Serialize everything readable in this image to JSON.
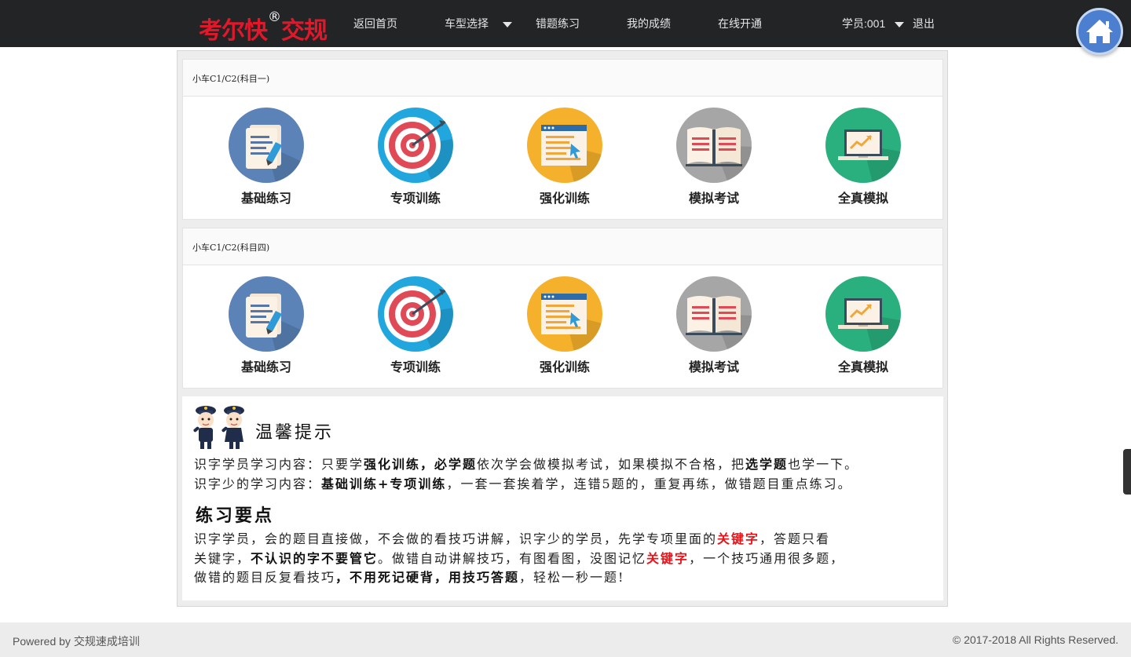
{
  "header": {
    "brand": "考尔快",
    "brand_reg": "®",
    "brand_suffix": "交规",
    "nav": {
      "home": "返回首页",
      "car_type": "车型选择",
      "wrong": "错题练习",
      "scores": "我的成绩",
      "online": "在线开通"
    },
    "user": "学员:001",
    "logout": "退出"
  },
  "sections": [
    {
      "title": "小车C1/C2(科目一)",
      "items": [
        "基础练习",
        "专项训练",
        "强化训练",
        "模拟考试",
        "全真模拟"
      ]
    },
    {
      "title": "小车C1/C2(科目四)",
      "items": [
        "基础练习",
        "专项训练",
        "强化训练",
        "模拟考试",
        "全真模拟"
      ]
    }
  ],
  "tips": {
    "title": "温馨提示",
    "line1": {
      "a": "识字学员学习内容：只要学",
      "b": "强化训练，必学题",
      "c": "依次学会做模拟考试，如果模拟不合格，把",
      "d": "选学题",
      "e": "也学一下。"
    },
    "line2": {
      "a": "识字少的学习内容：",
      "b": "基础训练+专项训练",
      "c": "，一套一套挨着学，连错5题的，重复再练，做错题目重点练习。"
    },
    "points_title": "练习要点",
    "p1": {
      "a": "识字学员，会的题目直接做，不会做的看技巧讲解，识字少的学员，先学专项里面的",
      "b": "关键字",
      "c": "，答题只看"
    },
    "p2": {
      "a": "关键字，",
      "b": "不认识的字不要管它",
      "c": "。做错自动讲解技巧，有图看图，没图记忆",
      "d": "关键字",
      "e": "，一个技巧通用很多题，"
    },
    "p3": {
      "a": "做错的题目反复看技巧",
      "b": "，不用死记硬背，用技巧答题",
      "c": "，轻松一秒一题!"
    }
  },
  "footer": {
    "left": "Powered by 交规速成培训",
    "right": "© 2017-2018 All Rights Reserved."
  },
  "colors": {
    "topbar": "#222426",
    "brand": "#e0182a",
    "keyword_red": "#e4161c"
  }
}
